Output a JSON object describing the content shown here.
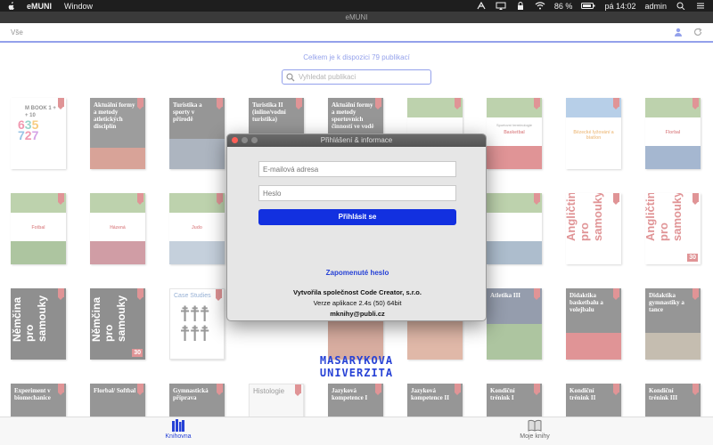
{
  "menubar": {
    "app_name": "eMUNI",
    "window_menu": "Window",
    "battery": "86 %",
    "clock": "pá 14:02",
    "user": "admin"
  },
  "window": {
    "title": "eMUNI"
  },
  "toolbar": {
    "filter_label": "Vše"
  },
  "main": {
    "count_text": "Celkem je k dispozici 79 publikací",
    "search_placeholder": "Vyhledat publikaci"
  },
  "books": [
    {
      "text": "M BOOK 1 + + 10"
    },
    {
      "text": "Aktuální formy a metody atletických disciplín"
    },
    {
      "text": "Turistika a sporty v přírodě"
    },
    {
      "text": "Turistika II (inline/vodní turistika)"
    },
    {
      "text": "Aktuální formy a metody sportovních činností ve vodě"
    },
    {
      "text": "Sportovní terminologie"
    },
    {
      "text": "Basketbal"
    },
    {
      "text": "Bězecké lyžování a biatlon"
    },
    {
      "text": "Florbal"
    },
    {
      "text": "Fotbal"
    },
    {
      "text": "Házená"
    },
    {
      "text": "Judo"
    },
    {
      "text": "Angličtina pro samouky"
    },
    {
      "text": "Němčina pro samouky"
    },
    {
      "text": "Case Studies"
    },
    {
      "text": "Atletika III"
    },
    {
      "text": "Didaktika basketbalu a volejbalu"
    },
    {
      "text": "Didaktika gymnastiky a tance"
    },
    {
      "text": "Experiment v biomechanice"
    },
    {
      "text": "Florbal/ Softbal"
    },
    {
      "text": "Gymnastická příprava"
    },
    {
      "text": "Histologie"
    },
    {
      "text": "Jazyková kompetence I"
    },
    {
      "text": "Jazyková kompetence II"
    },
    {
      "text": "Kondiční trénink I"
    },
    {
      "text": "Kondiční trénink II"
    },
    {
      "text": "Kondiční trénink III"
    }
  ],
  "musaic": {
    "line1": "MASARYKOVA",
    "line2": "UNIVERZITA"
  },
  "dialog": {
    "title": "Přihlášení & informace",
    "email_placeholder": "E-mailová adresa",
    "password_placeholder": "Heslo",
    "login_label": "Přihlásit se",
    "forgot_label": "Zapomenuté heslo",
    "creator": "Vytvořila společnost Code Creator, s.r.o.",
    "version": "Verze aplikace 2.4s (50) 64bit",
    "email": "mknihy@publi.cz"
  },
  "tabbar": {
    "library_label": "Knihovna",
    "mybooks_label": "Moje knihy"
  },
  "colors": {
    "accent": "#2742d6",
    "login_button": "#1230e0",
    "bookmark": "#c0282d"
  }
}
